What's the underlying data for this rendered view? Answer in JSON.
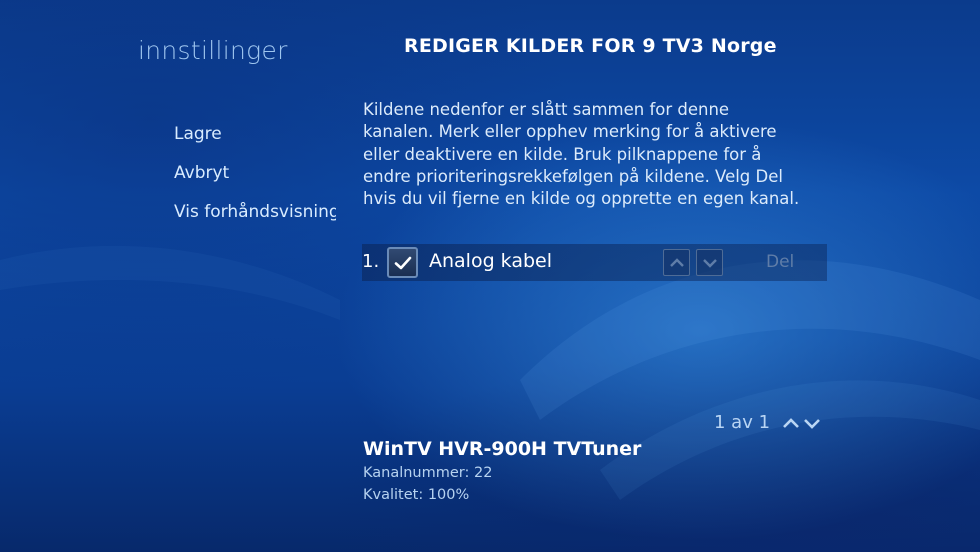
{
  "section_title": "innstillinger",
  "page_title": "REDIGER KILDER FOR 9 TV3 Norge",
  "menu": {
    "items": [
      {
        "label": "Lagre"
      },
      {
        "label": "Avbryt"
      },
      {
        "label": "Vis forhåndsvisning"
      }
    ]
  },
  "description": "Kildene nedenfor er slått sammen for denne kanalen. Merk eller opphev merking for å aktivere eller deaktivere en kilde. Bruk pilknappene for å endre prioriteringsrekkefølgen på kildene. Velg Del hvis du vil fjerne en kilde og opprette en egen kanal.",
  "sources": [
    {
      "index": "1.",
      "name": "Analog kabel",
      "checked": true,
      "delete_label": "Del"
    }
  ],
  "pager": {
    "text": "1 av 1"
  },
  "tuner": {
    "name": "WinTV HVR-900H TVTuner",
    "channel_number": "Kanalnummer: 22",
    "quality": "Kvalitet: 100%"
  },
  "icons": {
    "check": "check-icon",
    "up": "chevron-up-icon",
    "down": "chevron-down-icon"
  },
  "colors": {
    "accent": "#9fc6ef",
    "background": "#0d4aa6",
    "disabled": "#5f7da8"
  }
}
